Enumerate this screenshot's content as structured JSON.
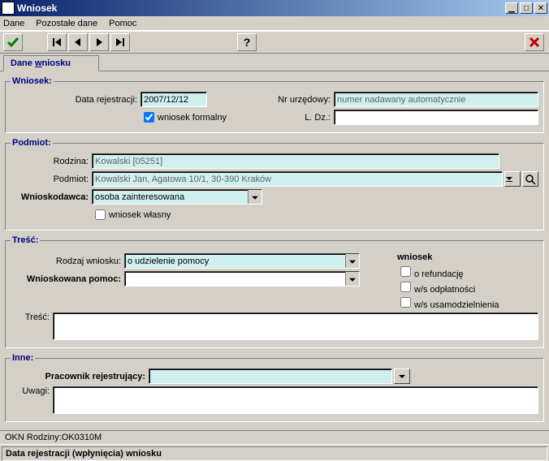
{
  "window": {
    "title": "Wniosek"
  },
  "menu": {
    "dane": "Dane",
    "pozostale": "Pozostałe dane",
    "pomoc": "Pomoc"
  },
  "tab": {
    "label_prefix": "Dane ",
    "label_underlined": "w",
    "label_suffix": "niosku"
  },
  "wniosek": {
    "legend": "Wniosek:",
    "data_rejestracji_label": "Data rejestracji:",
    "data_rejestracji": "2007/12/12",
    "wniosek_formalny_label": "wniosek formalny",
    "wniosek_formalny_checked": true,
    "nr_urzedowy_label": "Nr urzędowy:",
    "nr_urzedowy_placeholder": "numer nadawany automatycznie",
    "ldz_label": "L. Dz.:",
    "ldz": ""
  },
  "podmiot": {
    "legend": "Podmiot:",
    "rodzina_label": "Rodzina:",
    "rodzina": "Kowalski [05251]",
    "podmiot_label": "Podmiot:",
    "podmiot": "Kowalski Jan, Agatowa 10/1, 30-390 Kraków",
    "wnioskodawca_label": "Wnioskodawca:",
    "wnioskodawca": "osoba zainteresowana",
    "wniosek_wlasny_label": "wniosek własny",
    "wniosek_wlasny_checked": false
  },
  "tresc": {
    "legend": "Treść:",
    "rodzaj_label": "Rodzaj wniosku:",
    "rodzaj": "o udzielenie pomocy",
    "wnioskowana_label": "Wnioskowana pomoc:",
    "wnioskowana": "",
    "tresc_label": "Treść:",
    "tresc_text": "",
    "side_header": "wniosek",
    "opt_refundacje": "o refundację",
    "opt_odplatnosci": "w/s odpłatności",
    "opt_usamodzielnienia": "w/s usamodzielnienia"
  },
  "inne": {
    "legend": "Inne:",
    "pracownik_label": "Pracownik rejestrujący:",
    "pracownik": "",
    "uwagi_label": "Uwagi:",
    "uwagi_text": ""
  },
  "status": {
    "line1": "OKN Rodziny:OK0310M",
    "line2": "Data rejestracji (wpłynięcia) wniosku"
  }
}
